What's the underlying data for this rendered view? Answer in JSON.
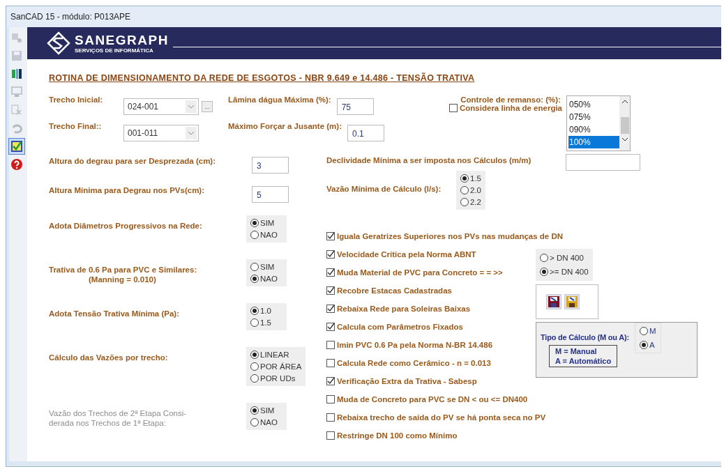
{
  "window": {
    "title": "SanCAD 15 - módulo: P013APE"
  },
  "toolbar": [
    {
      "kind": "edit",
      "disabled": true
    },
    {
      "kind": "save",
      "disabled": true
    },
    {
      "kind": "run",
      "disabled": false
    },
    {
      "kind": "screen",
      "disabled": true
    },
    {
      "kind": "cancel",
      "disabled": true
    },
    {
      "kind": "undo",
      "disabled": true
    },
    {
      "kind": "check",
      "disabled": false
    },
    {
      "kind": "help",
      "disabled": false
    }
  ],
  "banner": {
    "brand": "SANEGRAPH",
    "tagline": "SERVIÇOS DE INFORMÁTICA"
  },
  "heading": "ROTINA DE DIMENSIONAMENTO DA REDE DE ESGOTOS - NBR 9.649 e 14.486 - TENSÃO TRATIVA",
  "trecho_inicial": {
    "label": "Trecho Inicial:",
    "value": "024-001",
    "browse": "..."
  },
  "trecho_final": {
    "label": "Trecho Final::",
    "value": "001-011"
  },
  "lamina": {
    "label": "Lâmina dágua Máxima (%):",
    "value": "75"
  },
  "maximo_forcar": {
    "label": "Máximo Forçar a Jusante (m):",
    "value": "0.1"
  },
  "controle_remanso": {
    "label": "Controle de remanso: (%):",
    "options": [
      {
        "label": "050%",
        "selected": false
      },
      {
        "label": "075%",
        "selected": false
      },
      {
        "label": "090%",
        "selected": false
      },
      {
        "label": "100%",
        "selected": true
      }
    ]
  },
  "considera_linha": {
    "label": "Considera linha de energia",
    "checked": false
  },
  "left_fields": [
    {
      "label": "Altura do degrau para ser Desprezada (cm):",
      "value": "3"
    },
    {
      "label": "Altura Mínima para Degrau nos PVs(cm):",
      "value": "5"
    }
  ],
  "declividade": {
    "label": "Declividade Mínima a ser imposta nos Cálculos (m/m)"
  },
  "vazao_minima": {
    "label": "Vazão Mínima de Cálculo (l/s):",
    "options": [
      {
        "label": "1.5",
        "selected": true
      },
      {
        "label": "2.0",
        "selected": false
      },
      {
        "label": "2.2",
        "selected": false
      }
    ]
  },
  "left_radios": [
    {
      "lines": [
        "Adota Diâmetros Progressivos na Rede:"
      ],
      "disabled": false,
      "options": [
        {
          "label": "SIM",
          "selected": true
        },
        {
          "label": "NAO",
          "selected": false
        }
      ]
    },
    {
      "lines": [
        "Trativa de 0.6 Pa para PVC e Similares:",
        "(Manning = 0.010)"
      ],
      "disabled": false,
      "options": [
        {
          "label": "SIM",
          "selected": false
        },
        {
          "label": "NAO",
          "selected": true
        }
      ]
    },
    {
      "lines": [
        "Adota Tensão Trativa Mínima (Pa):"
      ],
      "disabled": false,
      "options": [
        {
          "label": "1.0",
          "selected": true
        },
        {
          "label": "1.5",
          "selected": false
        }
      ]
    },
    {
      "lines": [
        "Cálculo das Vazões por trecho:"
      ],
      "disabled": false,
      "options": [
        {
          "label": "LINEAR",
          "selected": true
        },
        {
          "label": "POR ÁREA",
          "selected": false
        },
        {
          "label": "POR UDs",
          "selected": false
        }
      ]
    },
    {
      "lines": [
        "Vazão dos Trechos de 2ª Etapa Consi-",
        "derada nos Trechos de 1ª Etapa:"
      ],
      "disabled": true,
      "options": [
        {
          "label": "SIM",
          "selected": true
        },
        {
          "label": "NAO",
          "selected": false
        }
      ]
    }
  ],
  "checks": [
    {
      "label": "Iguala Geratrizes Superiores nos PVs nas mudanças de DN",
      "checked": true
    },
    {
      "label": "Velocidade Crítica pela Norma ABNT",
      "checked": true
    },
    {
      "label": "Muda Material de PVC para Concreto = = >>",
      "checked": true
    },
    {
      "label": "Recobre Estacas Cadastradas",
      "checked": true
    },
    {
      "label": "Rebaixa Rede para Soleiras Baixas",
      "checked": true
    },
    {
      "label": "Calcula com Parâmetros Fixados",
      "checked": true
    },
    {
      "label": "Imin PVC 0.6 Pa pela Norma N-BR 14.486",
      "checked": false
    },
    {
      "label": "Calcula Rede como Cerâmico - n = 0.013",
      "checked": false
    },
    {
      "label": "Verificação Extra da Trativa - Sabesp",
      "checked": true
    },
    {
      "label": "Muda de Concreto para PVC se DN < ou <=  DN400",
      "checked": false
    },
    {
      "label": "Rebaixa trecho de saída do PV se há ponta seca no PV",
      "checked": false
    },
    {
      "label": "Restringe DN 100 como Mínimo",
      "checked": false
    }
  ],
  "dn_group": {
    "options": [
      {
        "label": "> DN 400",
        "selected": false
      },
      {
        "label": ">= DN 400",
        "selected": true
      }
    ]
  },
  "file_buttons": [
    {
      "kind": "load"
    },
    {
      "kind": "save"
    }
  ],
  "tipo_calculo": {
    "label": "Tipo de Cálculo (M ou A):",
    "legend": [
      "M = Manual",
      "A = Automático"
    ],
    "options": [
      {
        "label": "M",
        "selected": false
      },
      {
        "label": "A",
        "selected": true
      }
    ]
  }
}
